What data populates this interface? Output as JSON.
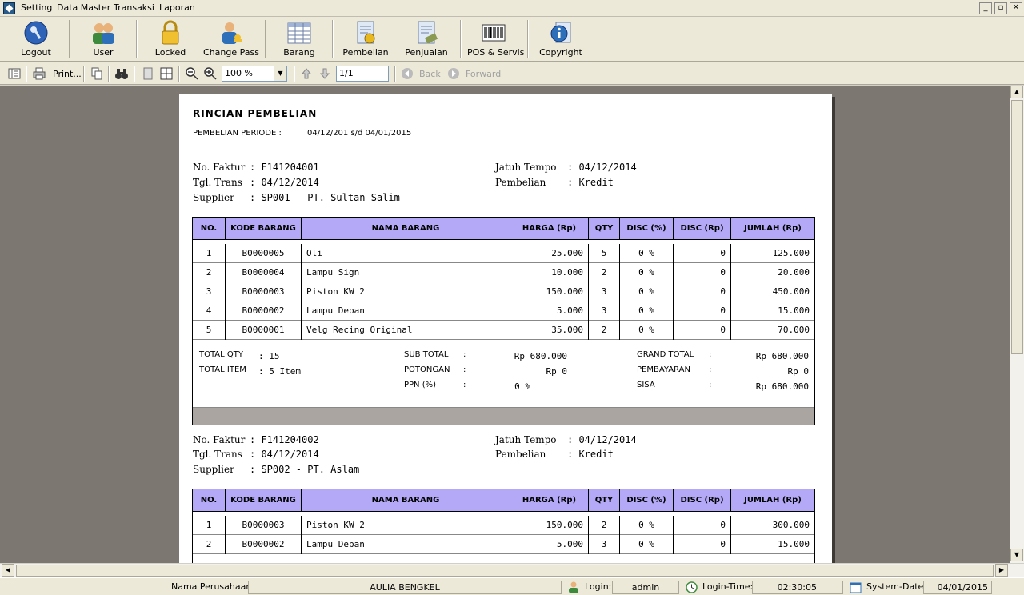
{
  "menu": [
    "Setting",
    "Data Master",
    "Transaksi",
    "Laporan"
  ],
  "window_buttons": [
    "_",
    "▫",
    "✕"
  ],
  "toolbar": {
    "buttons": [
      {
        "label": "Logout",
        "icon": "key-icon"
      },
      {
        "label": "User",
        "icon": "users-icon"
      },
      {
        "label": "Locked",
        "icon": "padlock-icon"
      },
      {
        "label": "Change Pass",
        "icon": "user-key-icon"
      },
      {
        "label": "Barang",
        "icon": "spreadsheet-icon"
      },
      {
        "label": "Pembelian",
        "icon": "purchase-document-icon"
      },
      {
        "label": "Penjualan",
        "icon": "sales-document-icon"
      },
      {
        "label": "POS & Servis",
        "icon": "barcode-icon"
      },
      {
        "label": "Copyright",
        "icon": "info-document-icon"
      }
    ]
  },
  "viewer": {
    "print_label": "Print...",
    "zoom": "100 %",
    "page": "1/1",
    "back_label": "Back",
    "forward_label": "Forward"
  },
  "report": {
    "title": "RINCIAN PEMBELIAN",
    "period_label": "PEMBELIAN PERIODE  :",
    "period_value": "04/12/201  s/d  04/01/2015",
    "columns": [
      "NO.",
      "KODE BARANG",
      "NAMA BARANG",
      "HARGA (Rp)",
      "QTY",
      "DISC (%)",
      "DISC (Rp)",
      "JUMLAH (Rp)"
    ],
    "invoices": [
      {
        "faktur_label": "No. Faktur",
        "faktur": ": F141204001",
        "tgl_label": "Tgl. Trans",
        "tgl": ": 04/12/2014",
        "supplier_label": "Supplier",
        "supplier": ": SP001 - PT. Sultan Salim",
        "tempo_label": "Jatuh Tempo",
        "tempo": ": 04/12/2014",
        "pembelian_label": "Pembelian",
        "pembelian": ": Kredit",
        "rows": [
          [
            "1",
            "B0000005",
            "Oli",
            "25.000",
            "5",
            "0 %",
            "0",
            "125.000"
          ],
          [
            "2",
            "B0000004",
            "Lampu Sign",
            "10.000",
            "2",
            "0 %",
            "0",
            "20.000"
          ],
          [
            "3",
            "B0000003",
            "Piston KW 2",
            "150.000",
            "3",
            "0 %",
            "0",
            "450.000"
          ],
          [
            "4",
            "B0000002",
            "Lampu Depan",
            "5.000",
            "3",
            "0 %",
            "0",
            "15.000"
          ],
          [
            "5",
            "B0000001",
            "Velg Recing Original",
            "35.000",
            "2",
            "0 %",
            "0",
            "70.000"
          ]
        ],
        "summary": {
          "total_qty_label": "TOTAL QTY",
          "total_qty": ":  15",
          "total_item_label": "TOTAL ITEM",
          "total_item": ":  5 Item",
          "sub_total_label": "SUB TOTAL",
          "sub_total": "Rp 680.000",
          "potongan_label": "POTONGAN",
          "potongan": "Rp 0",
          "ppn_label": "PPN (%)",
          "ppn": "0 %",
          "grand_total_label": "GRAND TOTAL",
          "grand_total": "Rp 680.000",
          "pembayaran_label": "PEMBAYARAN",
          "pembayaran": "Rp 0",
          "sisa_label": "SISA",
          "sisa": "Rp 680.000",
          "colon": ":"
        }
      },
      {
        "faktur_label": "No. Faktur",
        "faktur": ": F141204002",
        "tgl_label": "Tgl. Trans",
        "tgl": ": 04/12/2014",
        "supplier_label": "Supplier",
        "supplier": ": SP002 - PT. Aslam",
        "tempo_label": "Jatuh Tempo",
        "tempo": ": 04/12/2014",
        "pembelian_label": "Pembelian",
        "pembelian": ": Kredit",
        "rows": [
          [
            "1",
            "B0000003",
            "Piston KW 2",
            "150.000",
            "2",
            "0 %",
            "0",
            "300.000"
          ],
          [
            "2",
            "B0000002",
            "Lampu Depan",
            "5.000",
            "3",
            "0 %",
            "0",
            "15.000"
          ]
        ]
      }
    ]
  },
  "status": {
    "company_label": "Nama Perusahaan",
    "company": "AULIA BENGKEL",
    "login_label": "Login:",
    "login": "admin",
    "login_time_label": "Login-Time:",
    "login_time": "02:30:05",
    "system_date_label": "System-Date:",
    "system_date": "04/01/2015"
  }
}
